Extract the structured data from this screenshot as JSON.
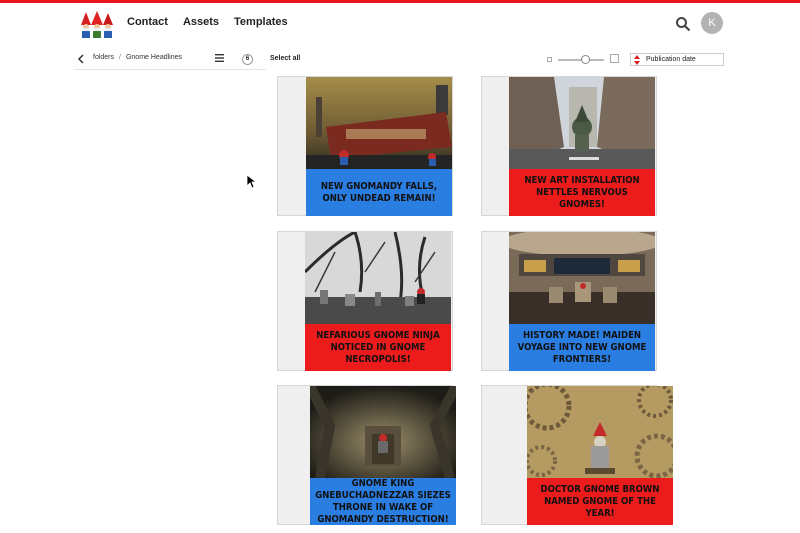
{
  "nav": {
    "items": [
      "Contact",
      "Assets",
      "Templates"
    ]
  },
  "user": {
    "avatar_initial": "K"
  },
  "breadcrumb": {
    "root": "folders",
    "separator": "/",
    "current": "Gnome Headlines"
  },
  "toolbar": {
    "count": "6",
    "select_all": "Select all",
    "sort": "Publication date",
    "size_slider_fraction": 0.6
  },
  "colors": {
    "accent": "#e8141b",
    "caption_blue": "#2a7de1",
    "caption_red": "#ec1c1c"
  },
  "assets": [
    {
      "caption": "New Gnomandy Falls, only undead remain!",
      "caption_color": "blue",
      "scene": "ruined city train"
    },
    {
      "caption": "New art installation nettles nervous gnomes!",
      "caption_color": "red",
      "scene": "city street statue"
    },
    {
      "caption": "Nefarious gnome ninja noticed in gnome necropolis!",
      "caption_color": "red",
      "scene": "graveyard"
    },
    {
      "caption": "History made! Maiden voyage into new gnome frontiers!",
      "caption_color": "blue",
      "scene": "starship bridge"
    },
    {
      "caption": "Gnome King Gnebuchadnezzar siezes throne in wake of Gnomandy destruction!",
      "caption_color": "blue",
      "scene": "throne cavern"
    },
    {
      "caption": "Doctor Gnome Brown named gnome of the year!",
      "caption_color": "red",
      "scene": "steampunk gears"
    }
  ]
}
